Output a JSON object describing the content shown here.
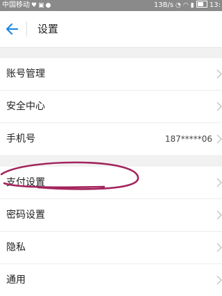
{
  "status_bar": {
    "carrier": "中国移动",
    "speed": "13B/s",
    "time": "13:"
  },
  "header": {
    "title": "设置"
  },
  "settings": {
    "group1": [
      {
        "label": "账号管理",
        "value": ""
      },
      {
        "label": "安全中心",
        "value": ""
      },
      {
        "label": "手机号",
        "value": "187*****06"
      }
    ],
    "group2": [
      {
        "label": "支付设置",
        "value": ""
      },
      {
        "label": "密码设置",
        "value": ""
      },
      {
        "label": "隐私",
        "value": ""
      },
      {
        "label": "通用",
        "value": ""
      }
    ]
  },
  "colors": {
    "accent": "#1e88e5",
    "annotation": "#a3245c"
  }
}
